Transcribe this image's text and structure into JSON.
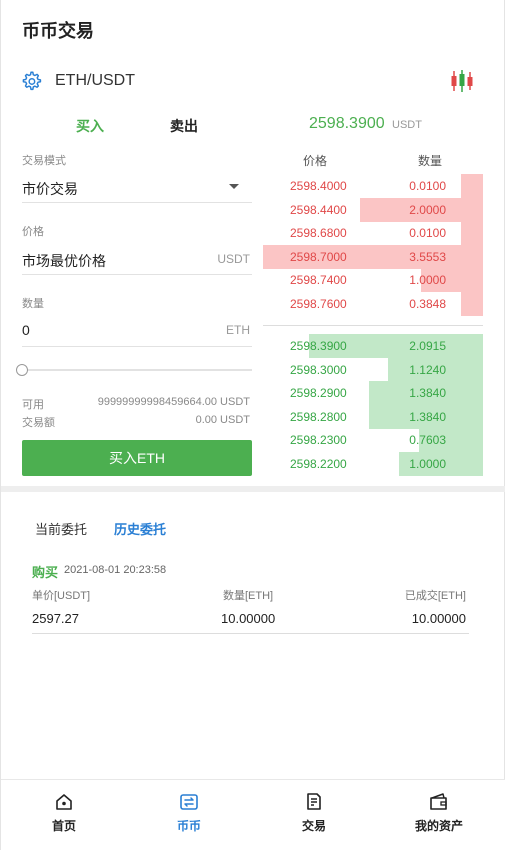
{
  "header": {
    "title": "币币交易"
  },
  "pair": {
    "symbol": "ETH/USDT",
    "settings_icon": "gear-icon",
    "chart_icon": "candlestick-icon"
  },
  "trade_tabs": {
    "buy": "买入",
    "sell": "卖出"
  },
  "last_price": {
    "value": "2598.3900",
    "unit": "USDT"
  },
  "form": {
    "mode_label": "交易模式",
    "mode_value": "市价交易",
    "price_label": "价格",
    "price_value": "市场最优价格",
    "price_unit": "USDT",
    "amount_label": "数量",
    "amount_value": "0",
    "amount_unit": "ETH",
    "slider_percent": 0,
    "available_label": "可用",
    "available_value": "99999999998459664.00 USDT",
    "turnover_label": "交易额",
    "turnover_value": "0.00 USDT",
    "submit_label": "买入ETH"
  },
  "orderbook": {
    "price_header": "价格",
    "qty_header": "数量",
    "asks": [
      {
        "price": "2598.4000",
        "qty": "0.0100",
        "depth": 0.1
      },
      {
        "price": "2598.4400",
        "qty": "2.0000",
        "depth": 0.56
      },
      {
        "price": "2598.6800",
        "qty": "0.0100",
        "depth": 0.1
      },
      {
        "price": "2598.7000",
        "qty": "3.5553",
        "depth": 1.0
      },
      {
        "price": "2598.7400",
        "qty": "1.0000",
        "depth": 0.28
      },
      {
        "price": "2598.7600",
        "qty": "0.3848",
        "depth": 0.1
      }
    ],
    "bids": [
      {
        "price": "2598.3900",
        "qty": "2.0915",
        "depth": 0.79
      },
      {
        "price": "2598.3000",
        "qty": "1.1240",
        "depth": 0.43
      },
      {
        "price": "2598.2900",
        "qty": "1.3840",
        "depth": 0.52
      },
      {
        "price": "2598.2800",
        "qty": "1.3840",
        "depth": 0.52
      },
      {
        "price": "2598.2300",
        "qty": "0.7603",
        "depth": 0.29
      },
      {
        "price": "2598.2200",
        "qty": "1.0000",
        "depth": 0.38
      }
    ]
  },
  "orders": {
    "tab_current": "当前委托",
    "tab_history": "历史委托",
    "items": [
      {
        "type": "购买",
        "time": "2021-08-01 20:23:58",
        "price_header": "单价[USDT]",
        "qty_header": "数量[ETH]",
        "filled_header": "已成交[ETH]",
        "price": "2597.27",
        "qty": "10.00000",
        "filled": "10.00000"
      }
    ]
  },
  "bottom_nav": [
    {
      "label": "首页",
      "icon": "home-icon"
    },
    {
      "label": "币币",
      "icon": "exchange-icon",
      "active": true
    },
    {
      "label": "交易",
      "icon": "trade-document-icon"
    },
    {
      "label": "我的资产",
      "icon": "wallet-icon"
    }
  ],
  "colors": {
    "buy_green": "#4caf50",
    "sell_red": "#e04848",
    "accent_blue": "#2a7fd4"
  }
}
